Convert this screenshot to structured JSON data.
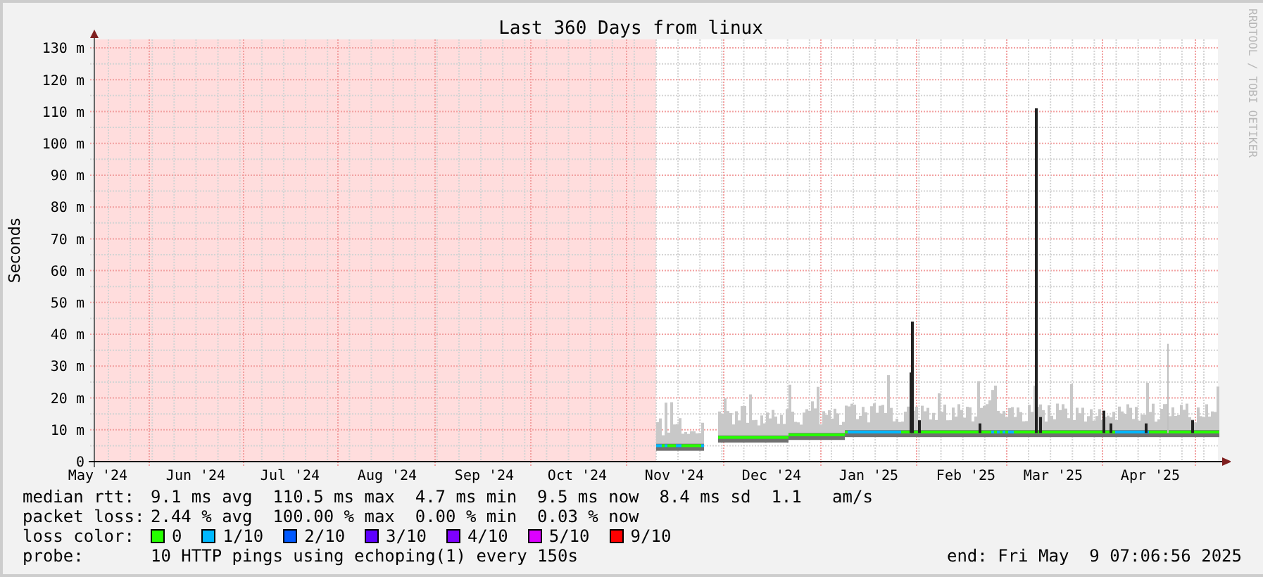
{
  "title": "Last 360 Days from linux",
  "y_axis": {
    "title": "Seconds",
    "ticks": [
      "130 m",
      "120 m",
      "110 m",
      "100 m",
      "90 m",
      "80 m",
      "70 m",
      "60 m",
      "50 m",
      "40 m",
      "30 m",
      "20 m",
      "10 m",
      "0"
    ]
  },
  "x_axis": {
    "labels": [
      "May '24",
      "Jun '24",
      "Jul '24",
      "Aug '24",
      "Sep '24",
      "Oct '24",
      "Nov '24",
      "Dec '24",
      "Jan '25",
      "Feb '25",
      "Mar '25",
      "Apr '25"
    ]
  },
  "stats": [
    {
      "label": "median rtt:",
      "value": "9.1 ms avg  110.5 ms max  4.7 ms min  9.5 ms now  8.4 ms sd  1.1   am/s"
    },
    {
      "label": "packet loss:",
      "value": "2.44 % avg  100.00 % max  0.00 % min  0.03 % now"
    }
  ],
  "loss_legend": {
    "label": "loss color:",
    "items": [
      {
        "label": "0",
        "color": "#26ff00"
      },
      {
        "label": "1/10",
        "color": "#00b8ff"
      },
      {
        "label": "2/10",
        "color": "#0059ff"
      },
      {
        "label": "3/10",
        "color": "#5e00ff"
      },
      {
        "label": "4/10",
        "color": "#7e00ff"
      },
      {
        "label": "5/10",
        "color": "#dd00ff"
      },
      {
        "label": "9/10",
        "color": "#ff0000"
      }
    ]
  },
  "probe": {
    "label": "probe:",
    "text": "10 HTTP pings using echoping(1) every 150s"
  },
  "end": "end: Fri May  9 07:06:56 2025",
  "credit": "RRDTOOL / TOBI OETIKER"
}
